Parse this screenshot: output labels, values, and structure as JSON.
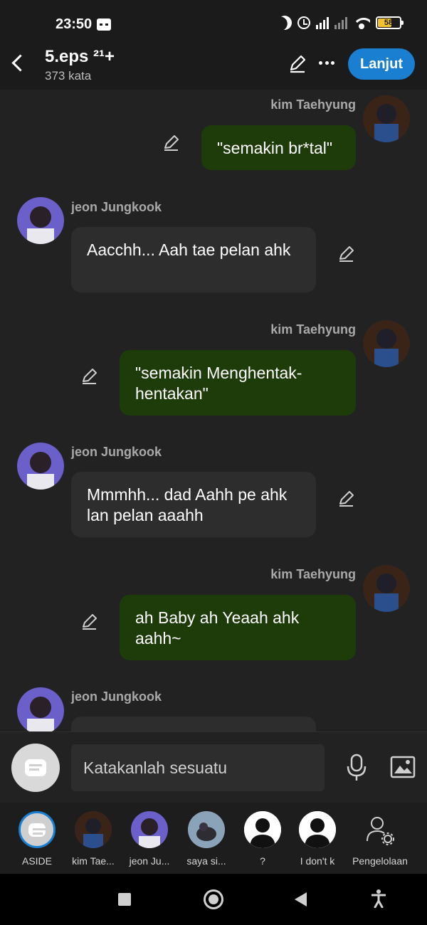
{
  "status_bar": {
    "time": "23:50",
    "battery": "58",
    "battery_level": 0.58
  },
  "header": {
    "title": "5.eps ²¹+",
    "word_count": "373 kata",
    "continue_label": "Lanjut"
  },
  "messages": [
    {
      "sender": "kim Taehyung",
      "side": "right",
      "text": "\"semakin br*tal\""
    },
    {
      "sender": "jeon Jungkook",
      "side": "left",
      "text": "Aacchh... Aah tae pelan ahk"
    },
    {
      "sender": "kim Taehyung",
      "side": "right",
      "text": "\"semakin Menghentak-hentakan\""
    },
    {
      "sender": "jeon Jungkook",
      "side": "left",
      "text": "Mmmhh... dad Aahh pe ahk lan pelan aaahh"
    },
    {
      "sender": "kim Taehyung",
      "side": "right",
      "text": "ah Baby ah Yeaah ahk aahh~"
    },
    {
      "sender": "jeon Jungkook",
      "side": "left",
      "text": ""
    }
  ],
  "composer": {
    "placeholder": "Katakanlah sesuatu"
  },
  "characters": [
    {
      "label": "ASIDE"
    },
    {
      "label": "kim Tae..."
    },
    {
      "label": "jeon Ju..."
    },
    {
      "label": "saya si..."
    },
    {
      "label": "?"
    },
    {
      "label": "I don't k"
    },
    {
      "label": "Pengelolaan"
    }
  ],
  "colors": {
    "accent": "#1a7fd1",
    "right_bubble": "#1e3b0a",
    "left_bubble": "#2d2d2d",
    "background": "#222222"
  }
}
